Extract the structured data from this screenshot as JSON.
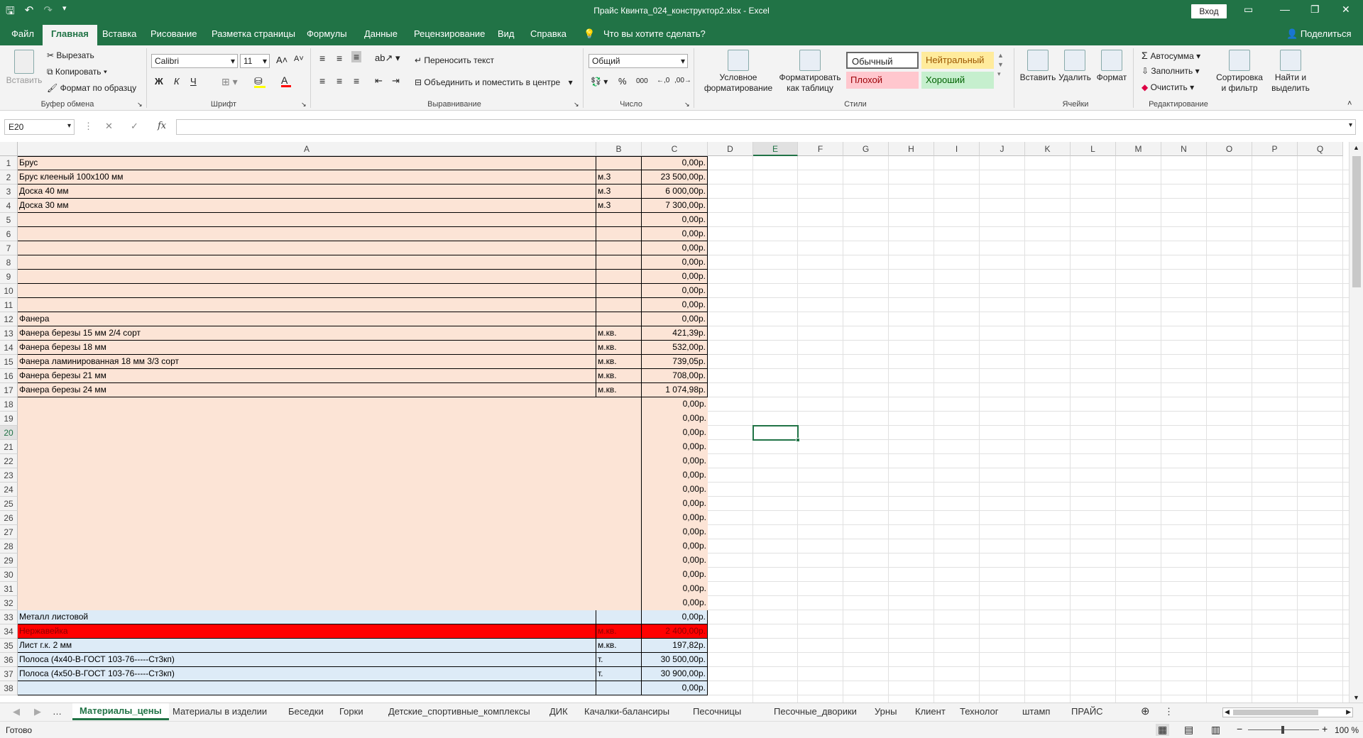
{
  "window": {
    "title": "Прайс Квинта_024_конструктор2.xlsx  -  Excel",
    "login_label": "Вход"
  },
  "menu": {
    "tabs": [
      "Файл",
      "Главная",
      "Вставка",
      "Рисование",
      "Разметка страницы",
      "Формулы",
      "Данные",
      "Рецензирование",
      "Вид",
      "Справка"
    ],
    "tell_me": "Что вы хотите сделать?",
    "share": "Поделиться"
  },
  "ribbon": {
    "clipboard": {
      "paste": "Вставить",
      "cut": "Вырезать",
      "copy": "Копировать",
      "format_painter": "Формат по образцу",
      "label": "Буфер обмена"
    },
    "font": {
      "name": "Calibri",
      "size": "11",
      "bold": "Ж",
      "italic": "К",
      "underline": "Ч",
      "label": "Шрифт"
    },
    "alignment": {
      "wrap": "Переносить текст",
      "merge": "Объединить и поместить в центре",
      "label": "Выравнивание"
    },
    "number": {
      "format": "Общий",
      "label": "Число"
    },
    "styles": {
      "conditional": "Условное форматирование",
      "as_table": "Форматировать как таблицу",
      "normal": "Обычный",
      "neutral": "Нейтральный",
      "bad": "Плохой",
      "good": "Хороший",
      "label": "Стили"
    },
    "cells": {
      "insert": "Вставить",
      "delete": "Удалить",
      "format": "Формат",
      "label": "Ячейки"
    },
    "editing": {
      "autosum": "Автосумма",
      "fill": "Заполнить",
      "clear": "Очистить",
      "sort": "Сортировка и фильтр",
      "find": "Найти и выделить",
      "label": "Редактирование"
    }
  },
  "formula_bar": {
    "name_box": "E20",
    "fx": "fx",
    "content": ""
  },
  "columns": [
    "A",
    "B",
    "C",
    "D",
    "E",
    "F",
    "G",
    "H",
    "I",
    "J",
    "K",
    "L",
    "M",
    "N",
    "O",
    "P",
    "Q"
  ],
  "selected_cell": "E20",
  "rows": [
    {
      "n": "1",
      "a": "Брус",
      "b": "",
      "c": "0,00р."
    },
    {
      "n": "2",
      "a": "Брус клееный 100х100 мм",
      "b": "м.3",
      "c": "23 500,00р."
    },
    {
      "n": "3",
      "a": "Доска 40 мм",
      "b": "м.3",
      "c": "6 000,00р."
    },
    {
      "n": "4",
      "a": "Доска 30 мм",
      "b": "м.3",
      "c": "7 300,00р."
    },
    {
      "n": "5",
      "a": "",
      "b": "",
      "c": "0,00р."
    },
    {
      "n": "6",
      "a": "",
      "b": "",
      "c": "0,00р."
    },
    {
      "n": "7",
      "a": "",
      "b": "",
      "c": "0,00р."
    },
    {
      "n": "8",
      "a": "",
      "b": "",
      "c": "0,00р."
    },
    {
      "n": "9",
      "a": "",
      "b": "",
      "c": "0,00р."
    },
    {
      "n": "10",
      "a": "",
      "b": "",
      "c": "0,00р."
    },
    {
      "n": "11",
      "a": "",
      "b": "",
      "c": "0,00р."
    },
    {
      "n": "12",
      "a": "Фанера",
      "b": "",
      "c": "0,00р."
    },
    {
      "n": "13",
      "a": "Фанера березы 15 мм 2/4 сорт",
      "b": "м.кв.",
      "c": "421,39р."
    },
    {
      "n": "14",
      "a": "Фанера березы 18 мм",
      "b": "м.кв.",
      "c": "532,00р."
    },
    {
      "n": "15",
      "a": "Фанера ламинированная 18 мм   3/3 сорт",
      "b": "м.кв.",
      "c": "739,05р."
    },
    {
      "n": "16",
      "a": "Фанера березы 21 мм",
      "b": "м.кв.",
      "c": "708,00р."
    },
    {
      "n": "17",
      "a": "Фанера березы 24 мм",
      "b": "м.кв.",
      "c": "1 074,98р."
    },
    {
      "n": "18",
      "a": "",
      "b": "",
      "c": "0,00р."
    },
    {
      "n": "19",
      "a": "",
      "b": "",
      "c": "0,00р."
    },
    {
      "n": "20",
      "a": "",
      "b": "",
      "c": "0,00р."
    },
    {
      "n": "21",
      "a": "",
      "b": "",
      "c": "0,00р."
    },
    {
      "n": "22",
      "a": "",
      "b": "",
      "c": "0,00р."
    },
    {
      "n": "23",
      "a": "",
      "b": "",
      "c": "0,00р."
    },
    {
      "n": "24",
      "a": "",
      "b": "",
      "c": "0,00р."
    },
    {
      "n": "25",
      "a": "",
      "b": "",
      "c": "0,00р."
    },
    {
      "n": "26",
      "a": "",
      "b": "",
      "c": "0,00р."
    },
    {
      "n": "27",
      "a": "",
      "b": "",
      "c": "0,00р."
    },
    {
      "n": "28",
      "a": "",
      "b": "",
      "c": "0,00р."
    },
    {
      "n": "29",
      "a": "",
      "b": "",
      "c": "0,00р."
    },
    {
      "n": "30",
      "a": "",
      "b": "",
      "c": "0,00р."
    },
    {
      "n": "31",
      "a": "",
      "b": "",
      "c": "0,00р."
    },
    {
      "n": "32",
      "a": "",
      "b": "",
      "c": "0,00р."
    },
    {
      "n": "33",
      "a": "Металл листовой",
      "b": "",
      "c": "0,00р."
    },
    {
      "n": "34",
      "a": "Нержавейка",
      "b": "м.кв.",
      "c": "2 400,00р."
    },
    {
      "n": "35",
      "a": "Лист г.к. 2 мм",
      "b": "м.кв.",
      "c": "197,82р."
    },
    {
      "n": "36",
      "a": "Полоса (4х40-В-ГОСТ 103-76-----Ст3кп)",
      "b": "т.",
      "c": "30 500,00р."
    },
    {
      "n": "37",
      "a": "Полоса (4х50-В-ГОСТ 103-76-----Ст3кп)",
      "b": "т.",
      "c": "30 900,00р."
    },
    {
      "n": "38",
      "a": "",
      "b": "",
      "c": "0,00р."
    }
  ],
  "colors": {
    "peach": "#fce4d6",
    "lightblue": "#ddebf7",
    "red": "#ff0000",
    "accent": "#217346"
  },
  "sheets": [
    "Материалы_цены",
    "Материалы в изделии",
    "Беседки",
    "Горки",
    "Детские_спортивные_комплексы",
    "ДИК",
    "Качалки-балансиры",
    "Песочницы",
    "Песочные_дворики",
    "Урны",
    "Клиент",
    "Технолог",
    "штамп",
    "ПРАЙС"
  ],
  "status": {
    "ready": "Готово",
    "zoom": "100 %"
  }
}
